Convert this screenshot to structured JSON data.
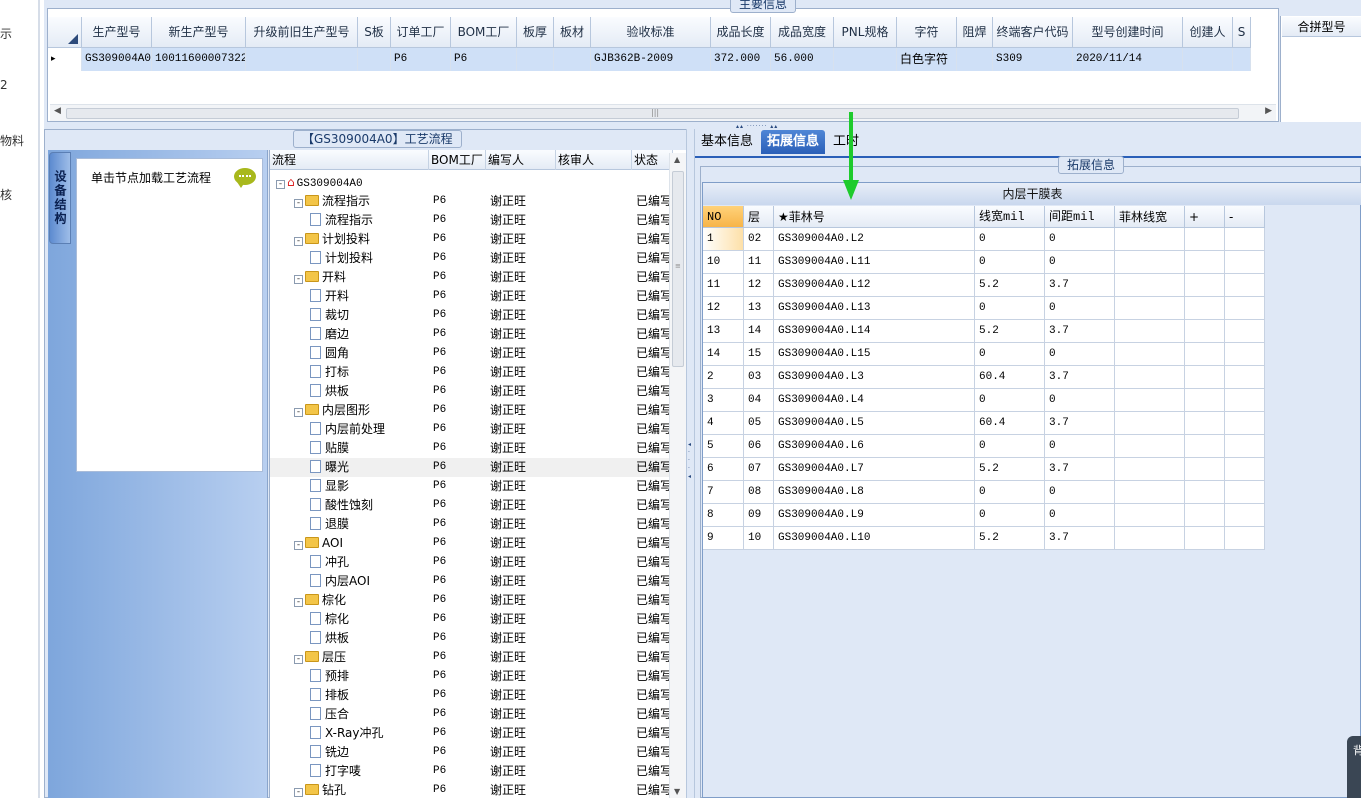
{
  "left_nav": {
    "items": [
      "示",
      "2",
      "物料",
      "核"
    ]
  },
  "main_info": {
    "title": "主要信息",
    "columns": [
      "生产型号",
      "新生产型号",
      "升级前旧生产型号",
      "S板",
      "订单工厂",
      "BOM工厂",
      "板厚",
      "板材",
      "验收标准",
      "成品长度",
      "成品宽度",
      "PNL规格",
      "字符",
      "阻焊",
      "终端客户代码",
      "型号创建时间",
      "创建人",
      "S"
    ],
    "row": [
      "GS309004A0",
      "10011600007322",
      "",
      "",
      "P6",
      "P6",
      "",
      "",
      "GJB362B-2009",
      "372.000",
      "56.000",
      "",
      "白色字符",
      "",
      "S309",
      "2020/11/14",
      "",
      ""
    ],
    "row_marker": "▸",
    "merge_header": "合拼型号"
  },
  "process": {
    "title": "【GS309004A0】工艺流程",
    "side_tab": "设备结构",
    "hint": "单击节点加载工艺流程",
    "columns": [
      "流程",
      "BOM工厂",
      "编写人",
      "核审人",
      "状态"
    ],
    "root": "GS309004A0",
    "rows": [
      {
        "name": "GS309004A0",
        "level": 0,
        "kind": "root",
        "bom": "",
        "writer": "",
        "status": ""
      },
      {
        "name": "流程指示",
        "level": 1,
        "kind": "folder",
        "bom": "P6",
        "writer": "谢正旺",
        "status": "已编写"
      },
      {
        "name": "流程指示",
        "level": 2,
        "kind": "doc",
        "bom": "P6",
        "writer": "谢正旺",
        "status": "已编写"
      },
      {
        "name": "计划投料",
        "level": 1,
        "kind": "folder",
        "bom": "P6",
        "writer": "谢正旺",
        "status": "已编写"
      },
      {
        "name": "计划投料",
        "level": 2,
        "kind": "doc",
        "bom": "P6",
        "writer": "谢正旺",
        "status": "已编写"
      },
      {
        "name": "开料",
        "level": 1,
        "kind": "folder",
        "bom": "P6",
        "writer": "谢正旺",
        "status": "已编写"
      },
      {
        "name": "开料",
        "level": 2,
        "kind": "doc",
        "bom": "P6",
        "writer": "谢正旺",
        "status": "已编写"
      },
      {
        "name": "裁切",
        "level": 2,
        "kind": "doc",
        "bom": "P6",
        "writer": "谢正旺",
        "status": "已编写"
      },
      {
        "name": "磨边",
        "level": 2,
        "kind": "doc",
        "bom": "P6",
        "writer": "谢正旺",
        "status": "已编写"
      },
      {
        "name": "圆角",
        "level": 2,
        "kind": "doc",
        "bom": "P6",
        "writer": "谢正旺",
        "status": "已编写"
      },
      {
        "name": "打标",
        "level": 2,
        "kind": "doc",
        "bom": "P6",
        "writer": "谢正旺",
        "status": "已编写"
      },
      {
        "name": "烘板",
        "level": 2,
        "kind": "doc",
        "bom": "P6",
        "writer": "谢正旺",
        "status": "已编写"
      },
      {
        "name": "内层图形",
        "level": 1,
        "kind": "folder",
        "bom": "P6",
        "writer": "谢正旺",
        "status": "已编写"
      },
      {
        "name": "内层前处理",
        "level": 2,
        "kind": "doc",
        "bom": "P6",
        "writer": "谢正旺",
        "status": "已编写"
      },
      {
        "name": "贴膜",
        "level": 2,
        "kind": "doc",
        "bom": "P6",
        "writer": "谢正旺",
        "status": "已编写"
      },
      {
        "name": "曝光",
        "level": 2,
        "kind": "doc",
        "bom": "P6",
        "writer": "谢正旺",
        "status": "已编写",
        "selected": true
      },
      {
        "name": "显影",
        "level": 2,
        "kind": "doc",
        "bom": "P6",
        "writer": "谢正旺",
        "status": "已编写"
      },
      {
        "name": "酸性蚀刻",
        "level": 2,
        "kind": "doc",
        "bom": "P6",
        "writer": "谢正旺",
        "status": "已编写"
      },
      {
        "name": "退膜",
        "level": 2,
        "kind": "doc",
        "bom": "P6",
        "writer": "谢正旺",
        "status": "已编写"
      },
      {
        "name": "AOI",
        "level": 1,
        "kind": "folder",
        "bom": "P6",
        "writer": "谢正旺",
        "status": "已编写"
      },
      {
        "name": "冲孔",
        "level": 2,
        "kind": "doc",
        "bom": "P6",
        "writer": "谢正旺",
        "status": "已编写"
      },
      {
        "name": "内层AOI",
        "level": 2,
        "kind": "doc",
        "bom": "P6",
        "writer": "谢正旺",
        "status": "已编写"
      },
      {
        "name": "棕化",
        "level": 1,
        "kind": "folder",
        "bom": "P6",
        "writer": "谢正旺",
        "status": "已编写"
      },
      {
        "name": "棕化",
        "level": 2,
        "kind": "doc",
        "bom": "P6",
        "writer": "谢正旺",
        "status": "已编写"
      },
      {
        "name": "烘板",
        "level": 2,
        "kind": "doc",
        "bom": "P6",
        "writer": "谢正旺",
        "status": "已编写"
      },
      {
        "name": "层压",
        "level": 1,
        "kind": "folder",
        "bom": "P6",
        "writer": "谢正旺",
        "status": "已编写"
      },
      {
        "name": "预排",
        "level": 2,
        "kind": "doc",
        "bom": "P6",
        "writer": "谢正旺",
        "status": "已编写"
      },
      {
        "name": "排板",
        "level": 2,
        "kind": "doc",
        "bom": "P6",
        "writer": "谢正旺",
        "status": "已编写"
      },
      {
        "name": "压合",
        "level": 2,
        "kind": "doc",
        "bom": "P6",
        "writer": "谢正旺",
        "status": "已编写"
      },
      {
        "name": "X-Ray冲孔",
        "level": 2,
        "kind": "doc",
        "bom": "P6",
        "writer": "谢正旺",
        "status": "已编写"
      },
      {
        "name": "铣边",
        "level": 2,
        "kind": "doc",
        "bom": "P6",
        "writer": "谢正旺",
        "status": "已编写"
      },
      {
        "name": "打字唛",
        "level": 2,
        "kind": "doc",
        "bom": "P6",
        "writer": "谢正旺",
        "status": "已编写"
      },
      {
        "name": "钻孔",
        "level": 1,
        "kind": "folder",
        "bom": "P6",
        "writer": "谢正旺",
        "status": "已编写"
      }
    ]
  },
  "tabs": {
    "items": [
      "基本信息",
      "拓展信息",
      "工时"
    ],
    "active": 1
  },
  "extended": {
    "title": "拓展信息",
    "table_caption": "内层干膜表",
    "columns": [
      "NO",
      "层",
      "★菲林号",
      "线宽mil",
      "间距mil",
      "菲林线宽",
      "+",
      "-"
    ],
    "rows": [
      [
        "1",
        "02",
        "GS309004A0.L2",
        "0",
        "0",
        "",
        "",
        ""
      ],
      [
        "10",
        "11",
        "GS309004A0.L11",
        "0",
        "0",
        "",
        "",
        ""
      ],
      [
        "11",
        "12",
        "GS309004A0.L12",
        "5.2",
        "3.7",
        "",
        "",
        ""
      ],
      [
        "12",
        "13",
        "GS309004A0.L13",
        "0",
        "0",
        "",
        "",
        ""
      ],
      [
        "13",
        "14",
        "GS309004A0.L14",
        "5.2",
        "3.7",
        "",
        "",
        ""
      ],
      [
        "14",
        "15",
        "GS309004A0.L15",
        "0",
        "0",
        "",
        "",
        ""
      ],
      [
        "2",
        "03",
        "GS309004A0.L3",
        "60.4",
        "3.7",
        "",
        "",
        ""
      ],
      [
        "3",
        "04",
        "GS309004A0.L4",
        "0",
        "0",
        "",
        "",
        ""
      ],
      [
        "4",
        "05",
        "GS309004A0.L5",
        "60.4",
        "3.7",
        "",
        "",
        ""
      ],
      [
        "5",
        "06",
        "GS309004A0.L6",
        "0",
        "0",
        "",
        "",
        ""
      ],
      [
        "6",
        "07",
        "GS309004A0.L7",
        "5.2",
        "3.7",
        "",
        "",
        ""
      ],
      [
        "7",
        "08",
        "GS309004A0.L8",
        "0",
        "0",
        "",
        "",
        ""
      ],
      [
        "8",
        "09",
        "GS309004A0.L9",
        "0",
        "0",
        "",
        "",
        ""
      ],
      [
        "9",
        "10",
        "GS309004A0.L10",
        "5.2",
        "3.7",
        "",
        "",
        ""
      ]
    ]
  },
  "corner_text": "背",
  "colors": {
    "accent_tab": "#2a5fb8",
    "arrow": "#1ecb2c",
    "selection": "#cfe0f7",
    "panel_bg": "#dfe8f6"
  },
  "icons": {
    "expand": "minus-box-icon",
    "folder": "folder-icon",
    "doc": "document-icon",
    "root": "house-icon",
    "hint": "speech-bubble-icon",
    "annotation": "green-arrow-down-icon"
  }
}
